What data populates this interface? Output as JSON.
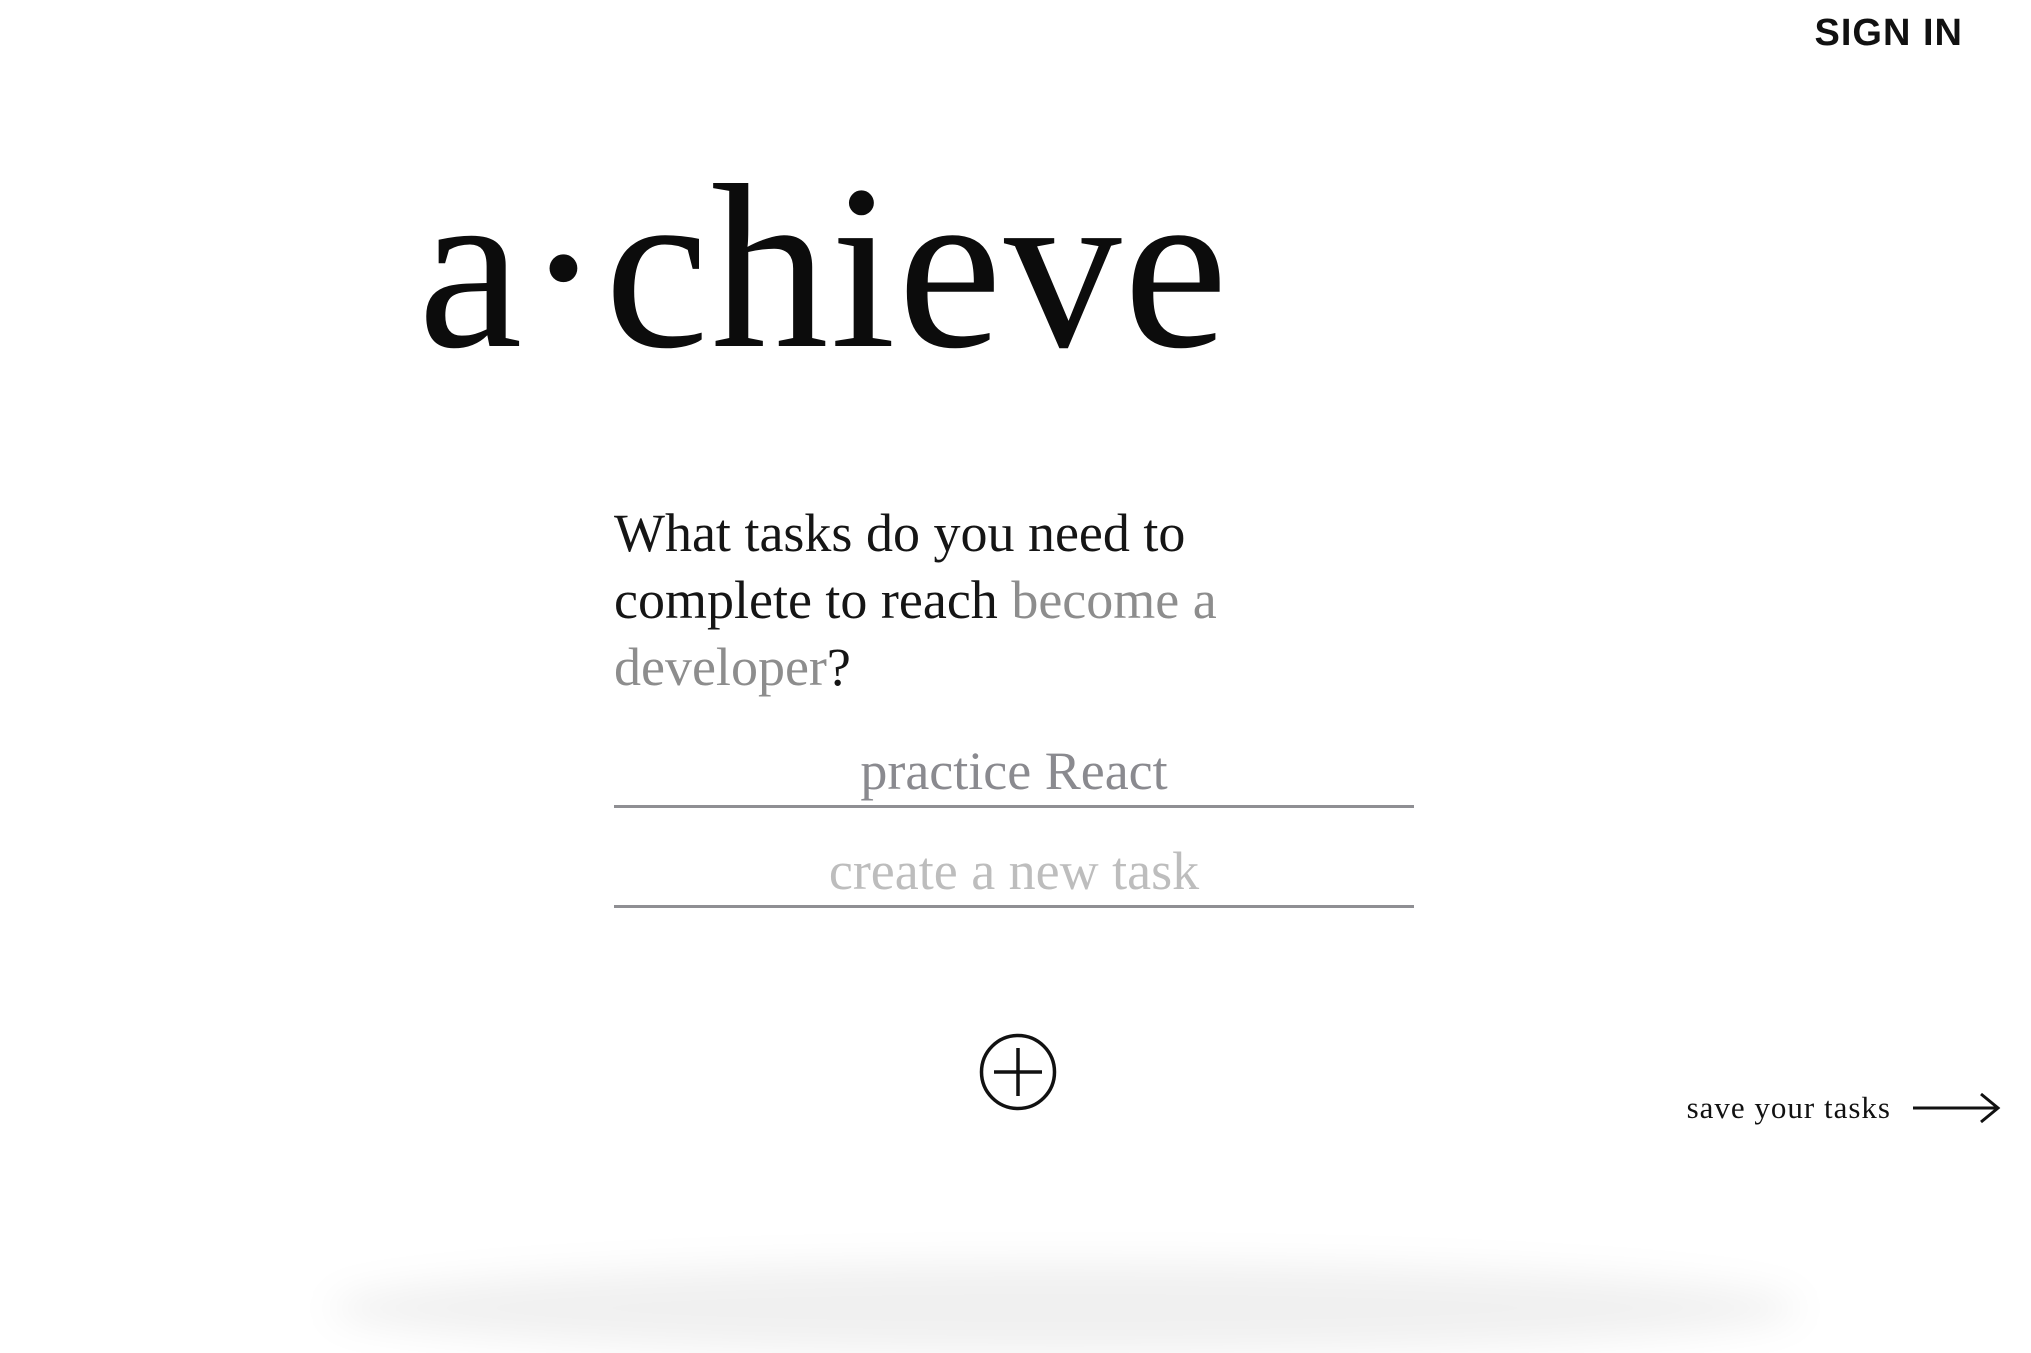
{
  "header": {
    "sign_in_label": "SIGN IN"
  },
  "logo": {
    "text": "a·chieve"
  },
  "prompt": {
    "text_before": "What tasks do you need to complete to reach ",
    "goal": "become a developer",
    "text_after": "?"
  },
  "tasks": {
    "existing_value": "practice React",
    "new_placeholder": "create a new task"
  },
  "actions": {
    "add_icon": "plus-circle-icon",
    "save_label": "save your tasks",
    "save_icon": "arrow-right-icon"
  }
}
